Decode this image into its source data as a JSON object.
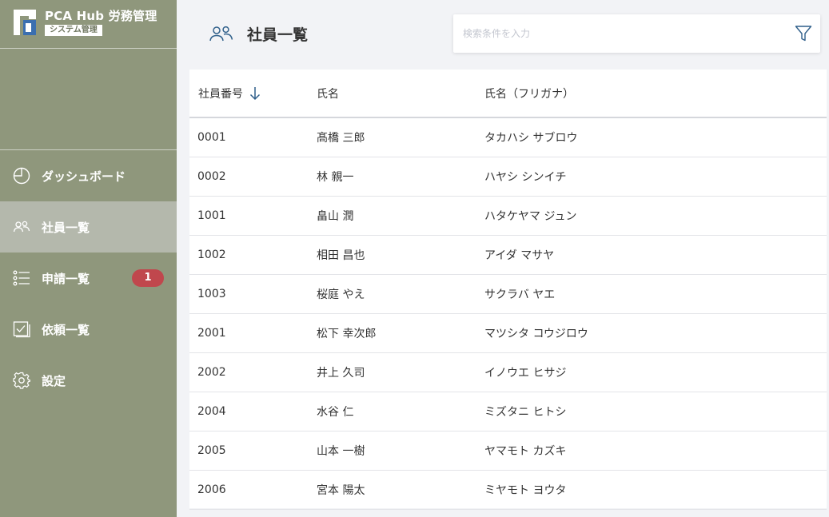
{
  "app": {
    "logo_title": "PCA Hub 労務管理",
    "logo_subtitle": "システム管理"
  },
  "sidebar": {
    "items": [
      {
        "label": "ダッシュボード",
        "icon": "pie-chart-icon"
      },
      {
        "label": "社員一覧",
        "icon": "users-icon",
        "active": true
      },
      {
        "label": "申請一覧",
        "icon": "list-icon",
        "badge": "1"
      },
      {
        "label": "依頼一覧",
        "icon": "checklist-icon"
      },
      {
        "label": "設定",
        "icon": "gear-icon"
      }
    ]
  },
  "header": {
    "title": "社員一覧",
    "icon": "users-icon"
  },
  "search": {
    "value": "",
    "placeholder": "検索条件を入力"
  },
  "table": {
    "columns": [
      "社員番号",
      "氏名",
      "氏名（フリガナ）"
    ],
    "sort": {
      "column": "社員番号",
      "direction": "desc",
      "icon": "arrow-down-icon"
    },
    "rows": [
      {
        "id": "0001",
        "name": "髙橋 三郎",
        "kana": "タカハシ サブロウ"
      },
      {
        "id": "0002",
        "name": "林 親一",
        "kana": "ハヤシ シンイチ"
      },
      {
        "id": "1001",
        "name": "畠山 潤",
        "kana": "ハタケヤマ ジュン"
      },
      {
        "id": "1002",
        "name": "相田 昌也",
        "kana": "アイダ マサヤ"
      },
      {
        "id": "1003",
        "name": "桜庭 やえ",
        "kana": "サクラバ ヤエ"
      },
      {
        "id": "2001",
        "name": "松下 幸次郎",
        "kana": "マツシタ コウジロウ"
      },
      {
        "id": "2002",
        "name": "井上 久司",
        "kana": "イノウエ ヒサジ"
      },
      {
        "id": "2004",
        "name": "水谷 仁",
        "kana": "ミズタニ ヒトシ"
      },
      {
        "id": "2005",
        "name": "山本 一樹",
        "kana": "ヤマモト カズキ"
      },
      {
        "id": "2006",
        "name": "宮本 陽太",
        "kana": "ミヤモト ヨウタ"
      }
    ]
  },
  "colors": {
    "sidebar_bg": "#8f977c",
    "sidebar_active_bg": "#b4b8ac",
    "badge_bg": "#c0474d",
    "accent": "#2f5f8a"
  }
}
